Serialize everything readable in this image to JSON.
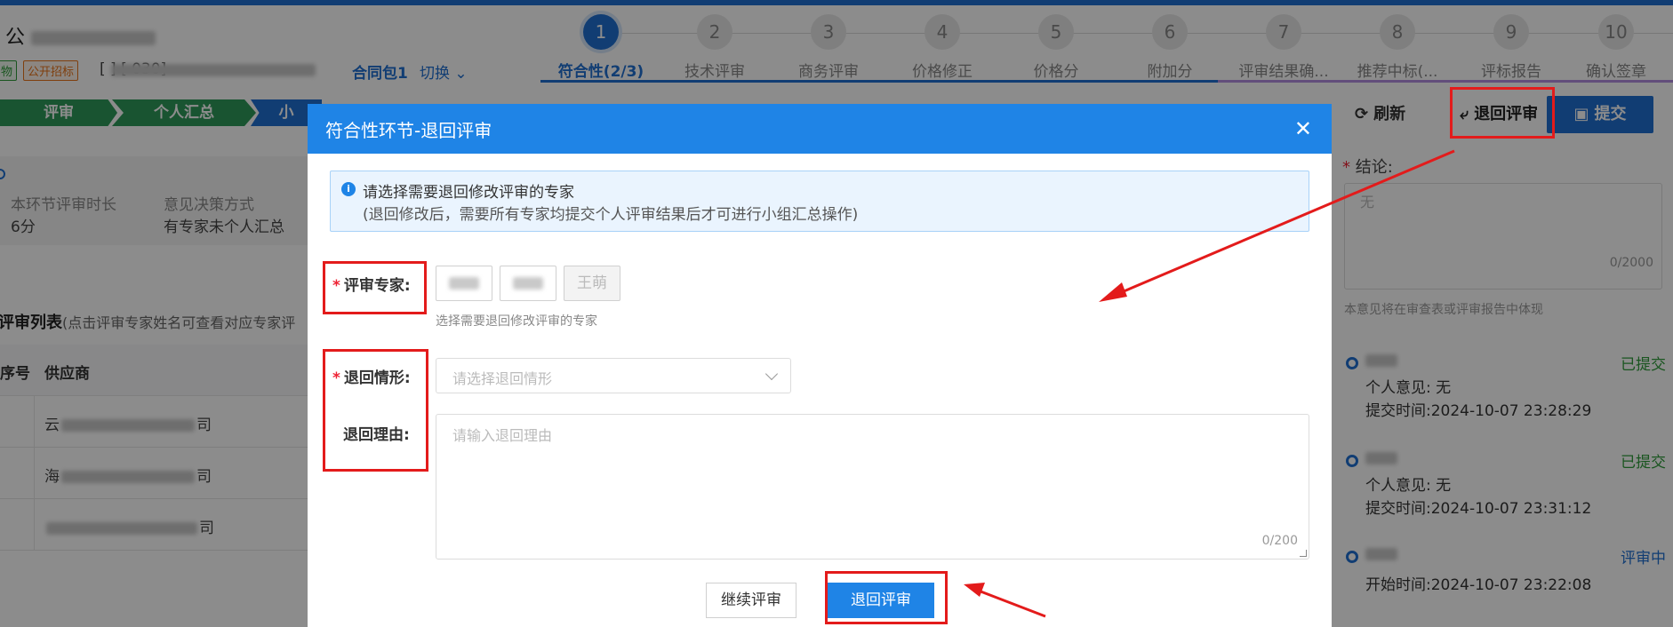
{
  "header": {
    "title_prefix": "公",
    "tag_green": "物",
    "tag_orange": "公开招标",
    "project_code": "[          ]   [          030]",
    "contract": "合同包1",
    "switch_label": "切换"
  },
  "steps": [
    {
      "num": "1",
      "label": "符合性(2/3)"
    },
    {
      "num": "2",
      "label": "技术评审"
    },
    {
      "num": "3",
      "label": "商务评审"
    },
    {
      "num": "4",
      "label": "价格修正"
    },
    {
      "num": "5",
      "label": "价格分"
    },
    {
      "num": "6",
      "label": "附加分"
    },
    {
      "num": "7",
      "label": "评审结果确..."
    },
    {
      "num": "8",
      "label": "推荐中标(..."
    },
    {
      "num": "9",
      "label": "评标报告"
    },
    {
      "num": "10",
      "label": "确认签章"
    }
  ],
  "phases": {
    "p1": "评审",
    "p2": "个人汇总",
    "p3": "小"
  },
  "toolbar": {
    "refresh": "刷新",
    "return": "退回评审",
    "submit": "提交"
  },
  "info": {
    "duration_label": "本环节评审时长",
    "duration_value": "6分",
    "decision_label": "意见决策方式",
    "decision_value": "有专家未个人汇总"
  },
  "list": {
    "title": "评审列表",
    "subtitle": "(点击评审专家姓名可查看对应专家评",
    "col_no": "序号",
    "col_supplier": "供应商",
    "rows": [
      {
        "prefix": "云",
        "suffix": "司"
      },
      {
        "prefix": "海",
        "suffix": "司"
      },
      {
        "prefix": "",
        "suffix": "司"
      }
    ]
  },
  "right_panel": {
    "conclusion_label": "结论:",
    "conclusion_placeholder": "无",
    "conclusion_count": "0/2000",
    "note": "本意见将在审查表或评审报告中体现",
    "timeline": [
      {
        "status": "已提交",
        "opinion_label": "个人意见:",
        "opinion": "无",
        "time_label": "提交时间:",
        "time": "2024-10-07 23:28:29"
      },
      {
        "status": "已提交",
        "opinion_label": "个人意见:",
        "opinion": "无",
        "time_label": "提交时间:",
        "time": "2024-10-07 23:31:12"
      },
      {
        "status": "评审中",
        "time_label": "开始时间:",
        "time": "2024-10-07 23:22:08"
      }
    ]
  },
  "modal": {
    "title": "符合性环节-退回评审",
    "alert_line1": "请选择需要退回修改评审的专家",
    "alert_line2": "(退回修改后，需要所有专家均提交个人评审结果后才可进行小组汇总操作)",
    "expert_label": "评审专家:",
    "experts": [
      "",
      "",
      "王萌"
    ],
    "expert_hint": "选择需要退回修改评审的专家",
    "situation_label": "退回情形:",
    "situation_placeholder": "请选择退回情形",
    "reason_label": "退回理由:",
    "reason_placeholder": "请输入退回理由",
    "reason_count": "0/200",
    "continue_button": "继续评审",
    "return_button": "退回评审"
  },
  "colors": {
    "primary": "#1f84e6",
    "annotation_red": "#e31b1b",
    "success_green": "#2e9b3a"
  }
}
